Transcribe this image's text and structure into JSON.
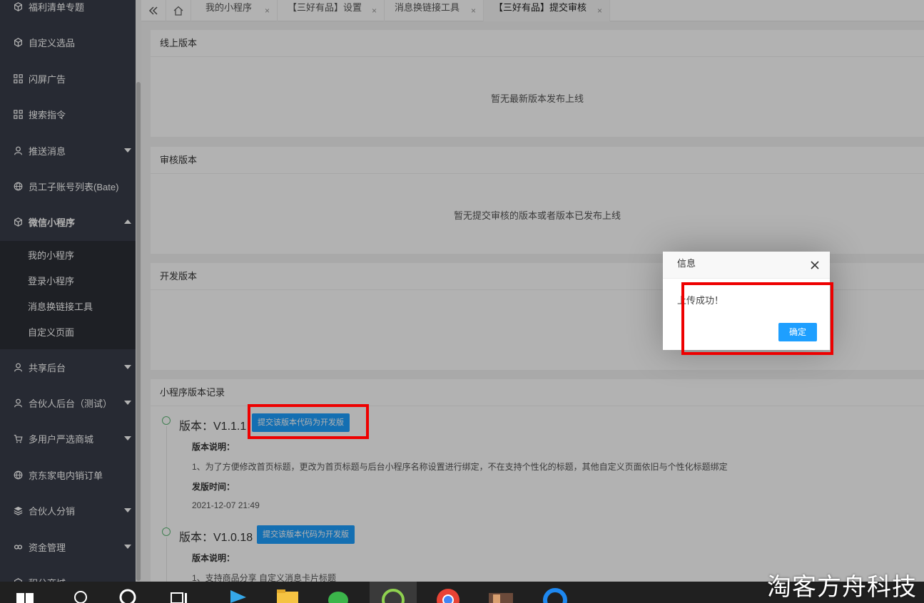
{
  "sidebar": {
    "items": [
      {
        "label": "福利清单专题",
        "icon": "cube-icon"
      },
      {
        "label": "自定义选品",
        "icon": "cube-icon"
      },
      {
        "label": "闪屏广告",
        "icon": "grid-icon"
      },
      {
        "label": "搜索指令",
        "icon": "grid-icon"
      },
      {
        "label": "推送消息",
        "icon": "user-icon"
      },
      {
        "label": "员工子账号列表(Bate)",
        "icon": "globe-icon"
      },
      {
        "label": "微信小程序",
        "icon": "cube-icon"
      },
      {
        "label": "共享后台",
        "icon": "user-icon"
      },
      {
        "label": "合伙人后台（测试）",
        "icon": "user-icon"
      },
      {
        "label": "多用户严选商城",
        "icon": "cart-icon"
      },
      {
        "label": "京东家电内销订单",
        "icon": "globe-icon"
      },
      {
        "label": "合伙人分销",
        "icon": "layers-icon"
      },
      {
        "label": "资金管理",
        "icon": "link-icon"
      },
      {
        "label": "积分商城",
        "icon": "cube-icon"
      }
    ],
    "subitems": [
      "我的小程序",
      "登录小程序",
      "消息换链接工具",
      "自定义页面"
    ]
  },
  "tabs": [
    {
      "label": "我的小程序"
    },
    {
      "label": "【三好有品】设置"
    },
    {
      "label": "消息换链接工具"
    },
    {
      "label": "【三好有品】提交审核"
    }
  ],
  "tab_close": "×",
  "cards": {
    "online": {
      "title": "线上版本",
      "empty": "暂无最新版本发布上线"
    },
    "review": {
      "title": "审核版本",
      "empty": "暂无提交审核的版本或者版本已发布上线"
    },
    "dev": {
      "title": "开发版本"
    },
    "history": {
      "title": "小程序版本记录"
    }
  },
  "versions": [
    {
      "title": "版本：V1.1.1",
      "button": "提交该版本代码为开发版",
      "desc_label": "版本说明：",
      "desc": "1、为了方便修改首页标题，更改为首页标题与后台小程序名称设置进行绑定，不在支持个性化的标题，其他自定义页面依旧与个性化标题绑定",
      "time_label": "发版时间：",
      "time": "2021-12-07 21:49"
    },
    {
      "title": "版本：V1.0.18",
      "button": "提交该版本代码为开发版",
      "desc_label": "版本说明：",
      "desc": "1、支持商品分享 自定义消息卡片标题"
    }
  ],
  "dialog": {
    "title": "信息",
    "message": "上传成功！",
    "ok": "确定"
  },
  "watermark": "淘客方舟科技",
  "colors": {
    "sidebar": "#393d49",
    "subnav": "#2b2e36",
    "primary": "#1e9fff",
    "highlight": "#e00000"
  }
}
